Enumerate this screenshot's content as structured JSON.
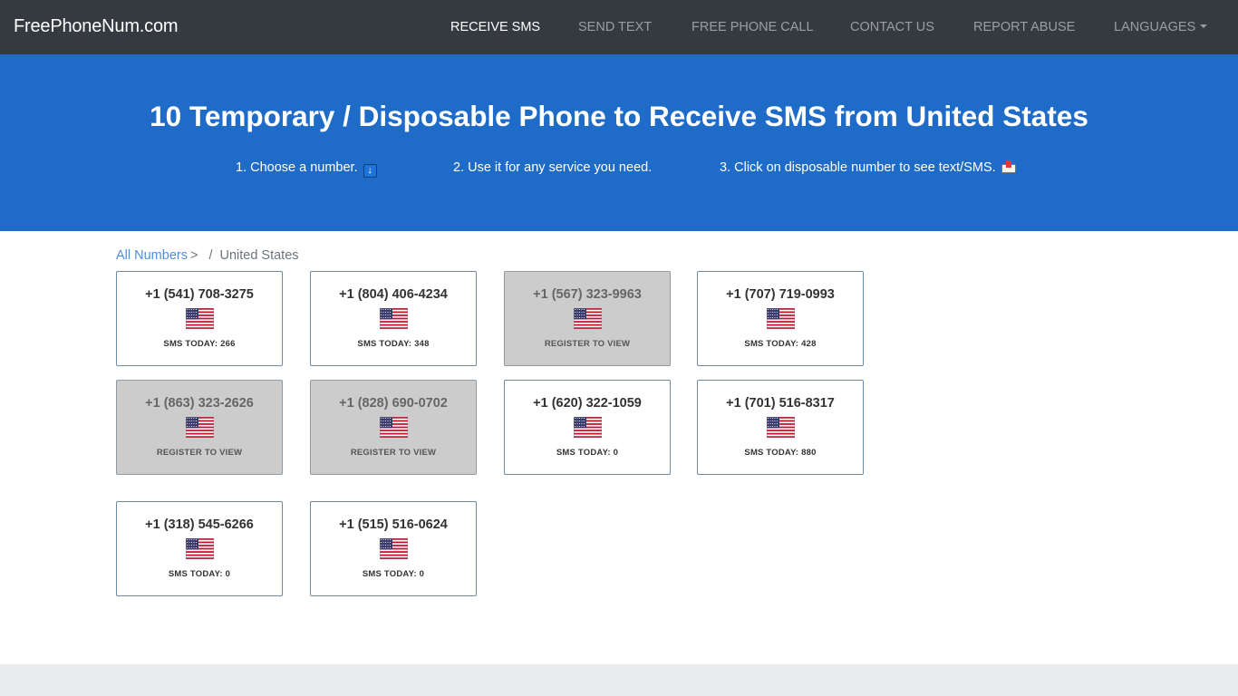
{
  "nav": {
    "brand": "FreePhoneNum.com",
    "items": [
      {
        "label": "RECEIVE SMS",
        "active": true
      },
      {
        "label": "SEND TEXT",
        "active": false
      },
      {
        "label": "FREE PHONE CALL",
        "active": false
      },
      {
        "label": "CONTACT US",
        "active": false
      },
      {
        "label": "REPORT ABUSE",
        "active": false
      },
      {
        "label": "LANGUAGES",
        "active": false
      }
    ]
  },
  "hero": {
    "title": "10 Temporary / Disposable Phone to Receive SMS from United States",
    "steps": [
      {
        "text": "1. Choose a number.",
        "icon": "down-arrow-icon"
      },
      {
        "text": "2. Use it for any service you need.",
        "icon": ""
      },
      {
        "text": "3. Click on disposable number to see text/SMS.",
        "icon": "inbox-tray-icon"
      }
    ]
  },
  "breadcrumb": {
    "all_label": "All Numbers",
    "gt": ">",
    "sep": "/",
    "current": "United States"
  },
  "numbers": [
    {
      "number": "+1 (541) 708-3275",
      "status": "SMS TODAY: 266",
      "locked": false
    },
    {
      "number": "+1 (804) 406-4234",
      "status": "SMS TODAY: 348",
      "locked": false
    },
    {
      "number": "+1 (567) 323-9963",
      "status": "REGISTER TO VIEW",
      "locked": true
    },
    {
      "number": "+1 (707) 719-0993",
      "status": "SMS TODAY: 428",
      "locked": false
    },
    {
      "number": "+1 (863) 323-2626",
      "status": "REGISTER TO VIEW",
      "locked": true
    },
    {
      "number": "+1 (828) 690-0702",
      "status": "REGISTER TO VIEW",
      "locked": true
    },
    {
      "number": "+1 (620) 322-1059",
      "status": "SMS TODAY: 0",
      "locked": false
    },
    {
      "number": "+1 (701) 516-8317",
      "status": "SMS TODAY: 880",
      "locked": false
    },
    {
      "number": "+1 (318) 545-6266",
      "status": "SMS TODAY: 0",
      "locked": false
    },
    {
      "number": "+1 (515) 516-0624",
      "status": "SMS TODAY: 0",
      "locked": false
    }
  ],
  "icons": {
    "flag": "us-flag-icon"
  },
  "colors": {
    "navbar": "#343a40",
    "hero": "#1f6cc8",
    "link": "#4f8fd6",
    "locked_card": "#cccccc",
    "footer": "#e9ecef"
  }
}
